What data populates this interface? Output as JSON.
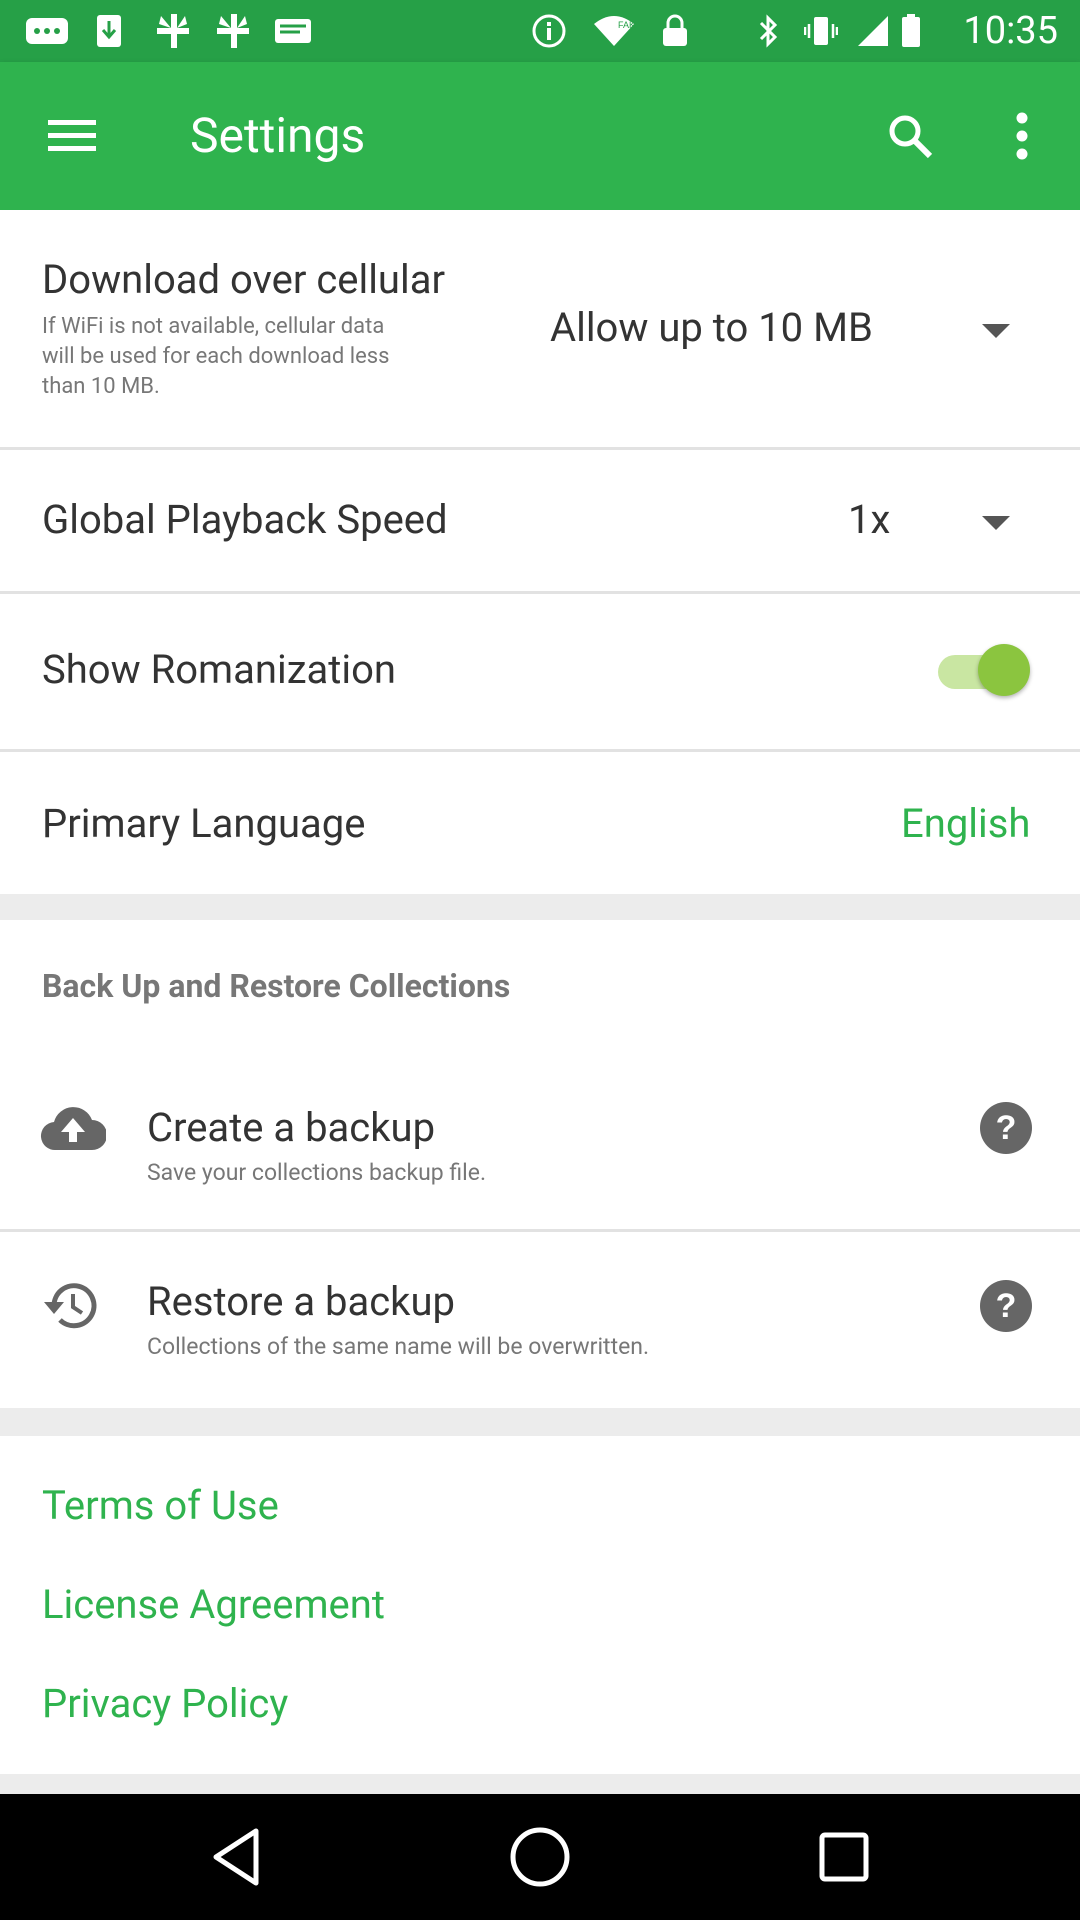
{
  "status_bar": {
    "time": "10:35",
    "left_icons": [
      "message-icon",
      "download-icon",
      "pinwheel-icon",
      "pinwheel-icon",
      "mail-icon",
      "info-icon",
      "wifi-icon",
      "lock-icon"
    ],
    "right_icons": [
      "bluetooth-icon",
      "vibrate-icon",
      "signal-icon",
      "battery-icon"
    ]
  },
  "app_bar": {
    "title": "Settings",
    "color": "#2fb34e"
  },
  "settings": {
    "cellular": {
      "title": "Download over cellular",
      "subtitle_line1": "If WiFi is not available, cellular data",
      "subtitle_line2": "will be used for each download less",
      "subtitle_line3": "than 10 MB.",
      "value": "Allow up to 10 MB"
    },
    "playback": {
      "title": "Global Playback Speed",
      "value": "1x"
    },
    "romanization": {
      "title": "Show Romanization",
      "enabled": true
    },
    "language": {
      "title": "Primary Language",
      "value": "English"
    }
  },
  "backup": {
    "header": "Back Up and Restore Collections",
    "create": {
      "title": "Create a backup",
      "subtitle": "Save your collections backup file."
    },
    "restore": {
      "title": "Restore a backup",
      "subtitle": "Collections of the same name will be overwritten."
    }
  },
  "links": {
    "terms": "Terms of Use",
    "license": "License Agreement",
    "privacy": "Privacy Policy"
  },
  "colors": {
    "accent": "#2fb34e",
    "status_bar": "#26a047",
    "toggle_on": "#8bc53f"
  }
}
